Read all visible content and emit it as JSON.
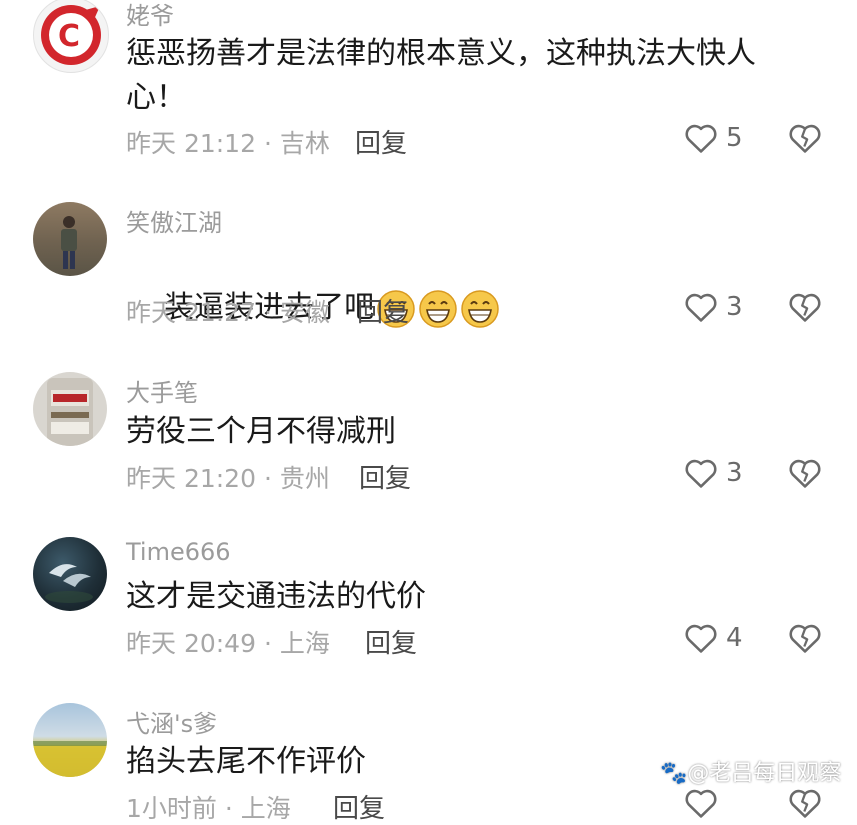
{
  "comments": [
    {
      "username": "姥爷",
      "text": "惩恶扬善才是法律的根本意义，这种执法大快人心！",
      "time": "昨天 21:12",
      "location": "吉林",
      "reply_label": "回复",
      "likes": "5"
    },
    {
      "username": "笑傲江湖",
      "text": "装逼装进去了吧",
      "time": "昨天 21:27",
      "location": "安徽",
      "reply_label": "回复",
      "likes": "3"
    },
    {
      "username": "大手笔",
      "text": "劳役三个月不得减刑",
      "time": "昨天 21:20",
      "location": "贵州",
      "reply_label": "回复",
      "likes": "3"
    },
    {
      "username": "Time666",
      "text": "这才是交通违法的代价",
      "time": "昨天 20:49",
      "location": "上海",
      "reply_label": "回复",
      "likes": "4"
    },
    {
      "username": "弋涵's爹",
      "text": "掐头去尾不作评价",
      "time": "1小时前",
      "location": "上海",
      "reply_label": "回复",
      "likes": ""
    }
  ],
  "separator": " · ",
  "watermark": "@老吕每日观察",
  "icons": {
    "like": "heart-outline-icon",
    "dislike": "broken-heart-icon",
    "emoji": "grinning-face-emoji"
  },
  "colors": {
    "username": "#9b9b9b",
    "text": "#1a1a1a",
    "meta": "#a7a7a7",
    "icon": "#6a6a6a"
  }
}
